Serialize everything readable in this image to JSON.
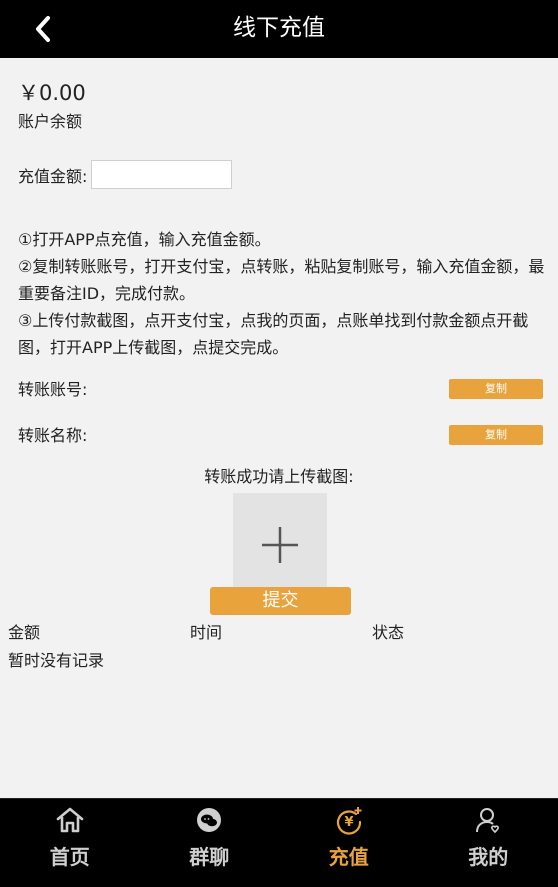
{
  "header": {
    "title": "线下充值"
  },
  "balance": {
    "amount": "￥0.00",
    "label": "账户余额"
  },
  "recharge": {
    "label": "充值金额:",
    "value": "",
    "placeholder": ""
  },
  "instructions": [
    "①打开APP点充值，输入充值金额。",
    "②复制转账账号，打开支付宝，点转账，粘贴复制账号，输入充值金额，最重要备注ID，完成付款。",
    "③上传付款截图，点开支付宝，点我的页面，点账单找到付款金额点开截图，打开APP上传截图，点提交完成。"
  ],
  "transfer": {
    "account_label": "转账账号:",
    "name_label": "转账名称:",
    "copy_label": "复制"
  },
  "upload": {
    "label": "转账成功请上传截图:"
  },
  "submit": {
    "label": "提交"
  },
  "records": {
    "columns": [
      "金额",
      "时间",
      "状态"
    ],
    "empty": "暂时没有记录"
  },
  "tabs": [
    {
      "label": "首页",
      "icon": "home-icon"
    },
    {
      "label": "群聊",
      "icon": "chat-icon"
    },
    {
      "label": "充值",
      "icon": "recharge-icon"
    },
    {
      "label": "我的",
      "icon": "profile-icon"
    }
  ],
  "active_tab": 2,
  "colors": {
    "accent": "#e8a33d",
    "header_bg": "#000000",
    "page_bg": "#f2f2f2"
  }
}
